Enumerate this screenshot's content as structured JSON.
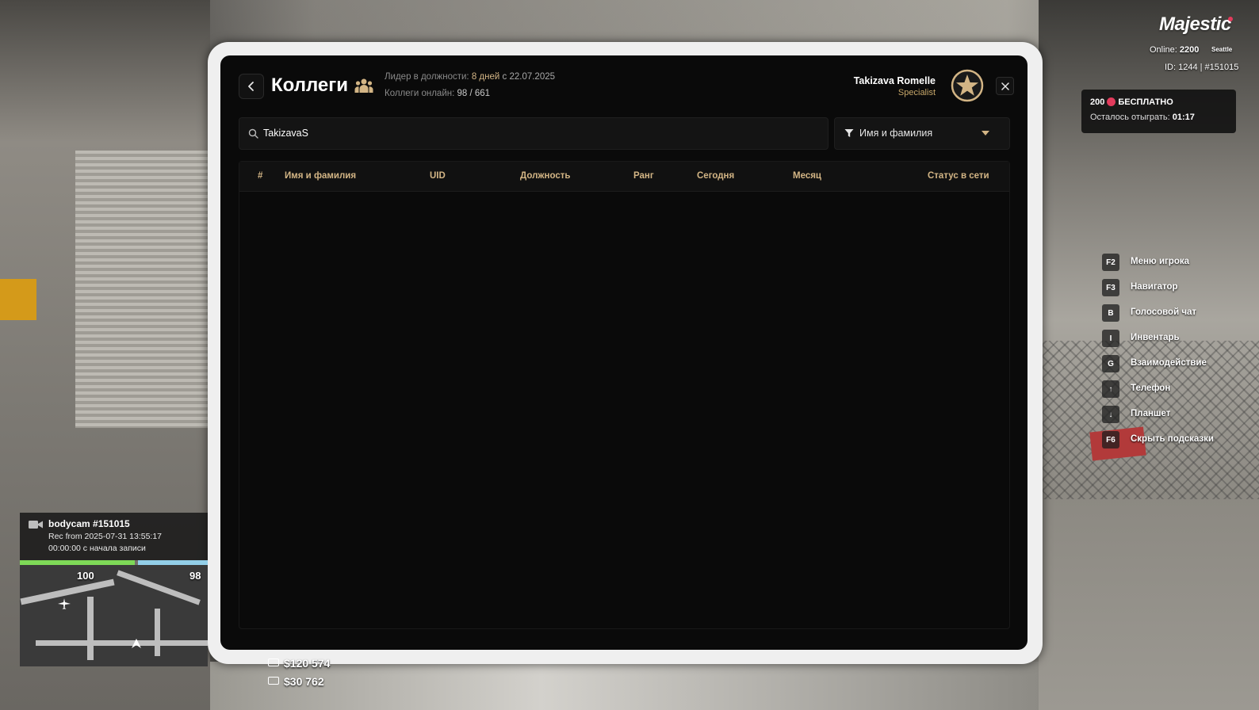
{
  "modal": {
    "title": "Коллеги",
    "leader_label": "Лидер в должности:",
    "leader_days": "8 дней",
    "leader_since": "с 22.07.2025",
    "online_label": "Коллеги онлайн:",
    "online_value": "98 / 661",
    "user_name": "Takizava Romelle",
    "user_role": "Specialist",
    "search": {
      "value": "TakizavaS"
    },
    "filter": {
      "selected": "Имя и фамилия"
    },
    "table": {
      "columns": [
        "#",
        "Имя и фамилия",
        "UID",
        "Должность",
        "Ранг",
        "Сегодня",
        "Месяц",
        "Статус в сети"
      ],
      "rows": []
    }
  },
  "hud": {
    "brand": "Majestic",
    "online_label": "Online:",
    "online_value": "2200",
    "server": "Seattle",
    "id_text": "ID: 1244 | #151015",
    "promo": {
      "amount": "200",
      "free_label": "БЕСПЛАТНО",
      "remaining_label": "Осталось отыграть:",
      "remaining_time": "01:17"
    },
    "hints": [
      {
        "key": "F2",
        "label": "Меню игрока"
      },
      {
        "key": "F3",
        "label": "Навигатор"
      },
      {
        "key": "B",
        "label": "Голосовой чат"
      },
      {
        "key": "I",
        "label": "Инвентарь"
      },
      {
        "key": "G",
        "label": "Взаимодействие"
      },
      {
        "key": "↑",
        "label": "Телефон"
      },
      {
        "key": "↓",
        "label": "Планшет"
      },
      {
        "key": "F6",
        "label": "Скрыть подсказки"
      }
    ],
    "bodycam": {
      "title": "bodycam #151015",
      "rec": "Rec from 2025-07-31 13:55:17",
      "elapsed": "00:00:00 с начала записи"
    },
    "health": "100",
    "armor": "98",
    "cash": "$120 574",
    "bank": "$30 762"
  },
  "colors": {
    "accent_gold": "#d3b585",
    "brand_pink": "#e23b5c",
    "health_green": "#7ed957",
    "armor_blue": "#93cfe8"
  }
}
